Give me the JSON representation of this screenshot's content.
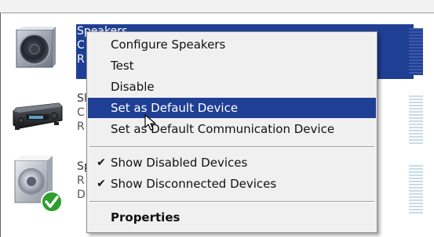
{
  "devices": [
    {
      "lines": [
        "Speakers",
        "C",
        "R"
      ],
      "icon": "speaker-icon",
      "selected": true
    },
    {
      "lines": [
        "Sl",
        "C",
        "R"
      ],
      "icon": "receiver-icon",
      "selected": false
    },
    {
      "lines": [
        "Sp",
        "R",
        "D"
      ],
      "icon": "speaker-default-icon",
      "selected": false
    }
  ],
  "context_menu": {
    "items": [
      {
        "label": "Configure Speakers"
      },
      {
        "label": "Test"
      },
      {
        "label": "Disable"
      },
      {
        "label": "Set as Default Device",
        "highlighted": true
      },
      {
        "label": "Set as Default Communication Device"
      },
      {
        "label": "Show Disabled Devices",
        "checked": true
      },
      {
        "label": "Show Disconnected Devices",
        "checked": true
      },
      {
        "label": "Properties",
        "bold": true
      }
    ],
    "check_glyph": "✔"
  },
  "colors": {
    "selection": "#1f3f94",
    "menu_bg": "#f0f0f0",
    "default_badge": "#2e9e2e"
  }
}
